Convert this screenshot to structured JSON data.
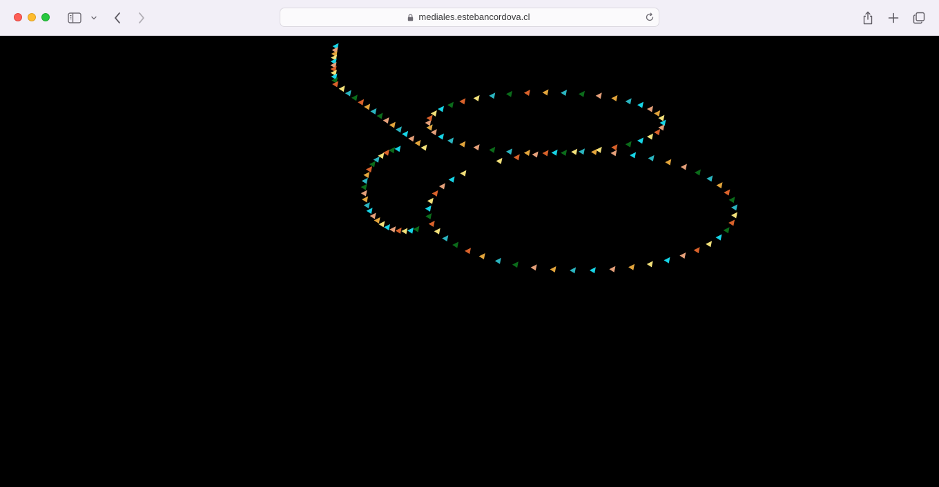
{
  "browser": {
    "url": "mediales.estebancordova.cl",
    "icons": {
      "close": "window-close-icon",
      "minimize": "window-minimize-icon",
      "maximize": "window-maximize-icon",
      "sidebar": "sidebar-icon",
      "sidebar_menu": "chevron-down-icon",
      "back": "chevron-left-icon",
      "forward": "chevron-right-icon",
      "lock": "lock-icon",
      "reload": "reload-icon",
      "share": "share-icon",
      "new_tab": "plus-icon",
      "tab_overview": "tabs-icon"
    }
  },
  "canvas": {
    "background": "#000000",
    "palette": [
      "#17d4e6",
      "#2bb5c0",
      "#f2e07a",
      "#e3a53c",
      "#d9622b",
      "#e5a07a",
      "#0b6b1a"
    ]
  }
}
